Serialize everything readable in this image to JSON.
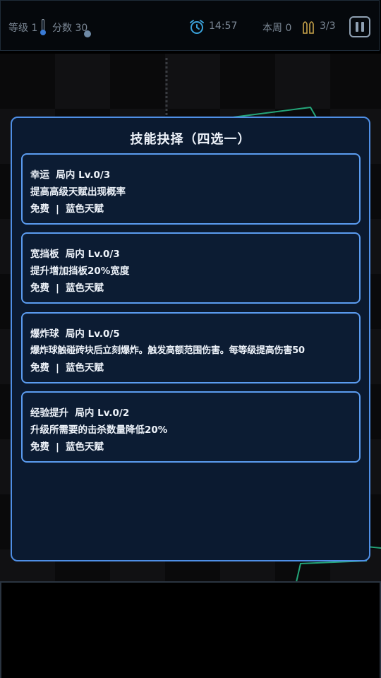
{
  "hud": {
    "level_label": "等级",
    "level_value": "1",
    "score_label": "分数",
    "score_value": "30",
    "timer": "14:57",
    "week_label": "本周",
    "week_value": "0",
    "ammo": "3/3"
  },
  "dialog": {
    "title": "技能抉择（四选一）",
    "options": [
      {
        "name": "幸运",
        "scope": "局内",
        "level": "Lv.0/3",
        "desc": "提高高级天赋出现概率",
        "cost": "免费",
        "rarity": "蓝色天赋"
      },
      {
        "name": "宽挡板",
        "scope": "局内",
        "level": "Lv.0/3",
        "desc": "提升增加挡板20%宽度",
        "cost": "免费",
        "rarity": "蓝色天赋"
      },
      {
        "name": "爆炸球",
        "scope": "局内",
        "level": "Lv.0/5",
        "desc": "爆炸球触碰砖块后立刻爆炸。触发高额范围伤害。每等级提高伤害50",
        "cost": "免费",
        "rarity": "蓝色天赋"
      },
      {
        "name": "经验提升",
        "scope": "局内",
        "level": "Lv.0/2",
        "desc": "升级所需要的击杀数量降低20%",
        "cost": "免费",
        "rarity": "蓝色天赋"
      }
    ],
    "separator": "|"
  },
  "colors": {
    "panel_bg": "#0b1a30",
    "panel_border": "#4f8fe6",
    "card_border": "#5b9cf0",
    "neon_green": "#2ee6a6"
  },
  "icons": {
    "thermometer": "thermometer-icon",
    "alarm": "alarm-clock-icon",
    "ammo": "bullets-icon",
    "pause": "pause-icon"
  }
}
